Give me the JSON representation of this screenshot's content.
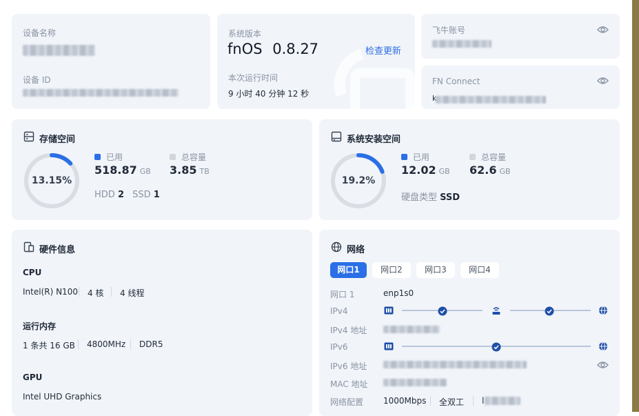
{
  "device": {
    "name_label": "设备名称",
    "id_label": "设备 ID"
  },
  "system": {
    "version_label": "系统版本",
    "os_name": "fnOS",
    "os_version": "0.8.27",
    "check_update": "检查更新",
    "uptime_label": "本次运行时间",
    "uptime": "9 小时 40 分钟 12 秒"
  },
  "account": {
    "label": "飞牛账号",
    "icon": "eye-icon"
  },
  "fn_connect": {
    "label": "FN Connect",
    "icon": "eye-icon",
    "value_prefix": "k"
  },
  "storage": {
    "title": "存储空间",
    "percent_text": "13.15%",
    "percent": 13.15,
    "used_label": "已用",
    "used_value": "518.87",
    "used_unit": "GB",
    "total_label": "总容量",
    "total_value": "3.85",
    "total_unit": "TB",
    "hdd_label": "HDD",
    "hdd_count": "2",
    "ssd_label": "SSD",
    "ssd_count": "1"
  },
  "sysdisk": {
    "title": "系统安装空间",
    "percent_text": "19.2%",
    "percent": 19.2,
    "used_label": "已用",
    "used_value": "12.02",
    "used_unit": "GB",
    "total_label": "总容量",
    "total_value": "62.6",
    "total_unit": "GB",
    "type_label": "硬盘类型",
    "type_value": "SSD"
  },
  "hardware": {
    "title": "硬件信息",
    "cpu_label": "CPU",
    "cpu_model": "Intel(R) N100",
    "cpu_cores": "4 核",
    "cpu_threads": "4 线程",
    "ram_label": "运行内存",
    "ram_modules": "1 条共 16 GB",
    "ram_speed": "4800MHz",
    "ram_type": "DDR5",
    "gpu_label": "GPU",
    "gpu_model": "Intel UHD Graphics"
  },
  "network": {
    "title": "网络",
    "tabs": [
      "网口1",
      "网口2",
      "网口3",
      "网口4"
    ],
    "active_tab": 0,
    "port_label": "网口 1",
    "port_value": "enp1s0",
    "ipv4_label": "IPv4",
    "ipv4_addr_label": "IPv4 地址",
    "ipv6_label": "IPv6",
    "ipv6_addr_label": "IPv6 地址",
    "mac_label": "MAC 地址",
    "config_label": "网络配置",
    "speed": "1000Mbps",
    "duplex": "全双工",
    "config_extra_prefix": "l"
  },
  "colors": {
    "accent": "#2b6fe6",
    "ring_track": "#d9dde4",
    "total_swatch": "#d1d5dc",
    "card_bg": "#f1f4f9"
  }
}
